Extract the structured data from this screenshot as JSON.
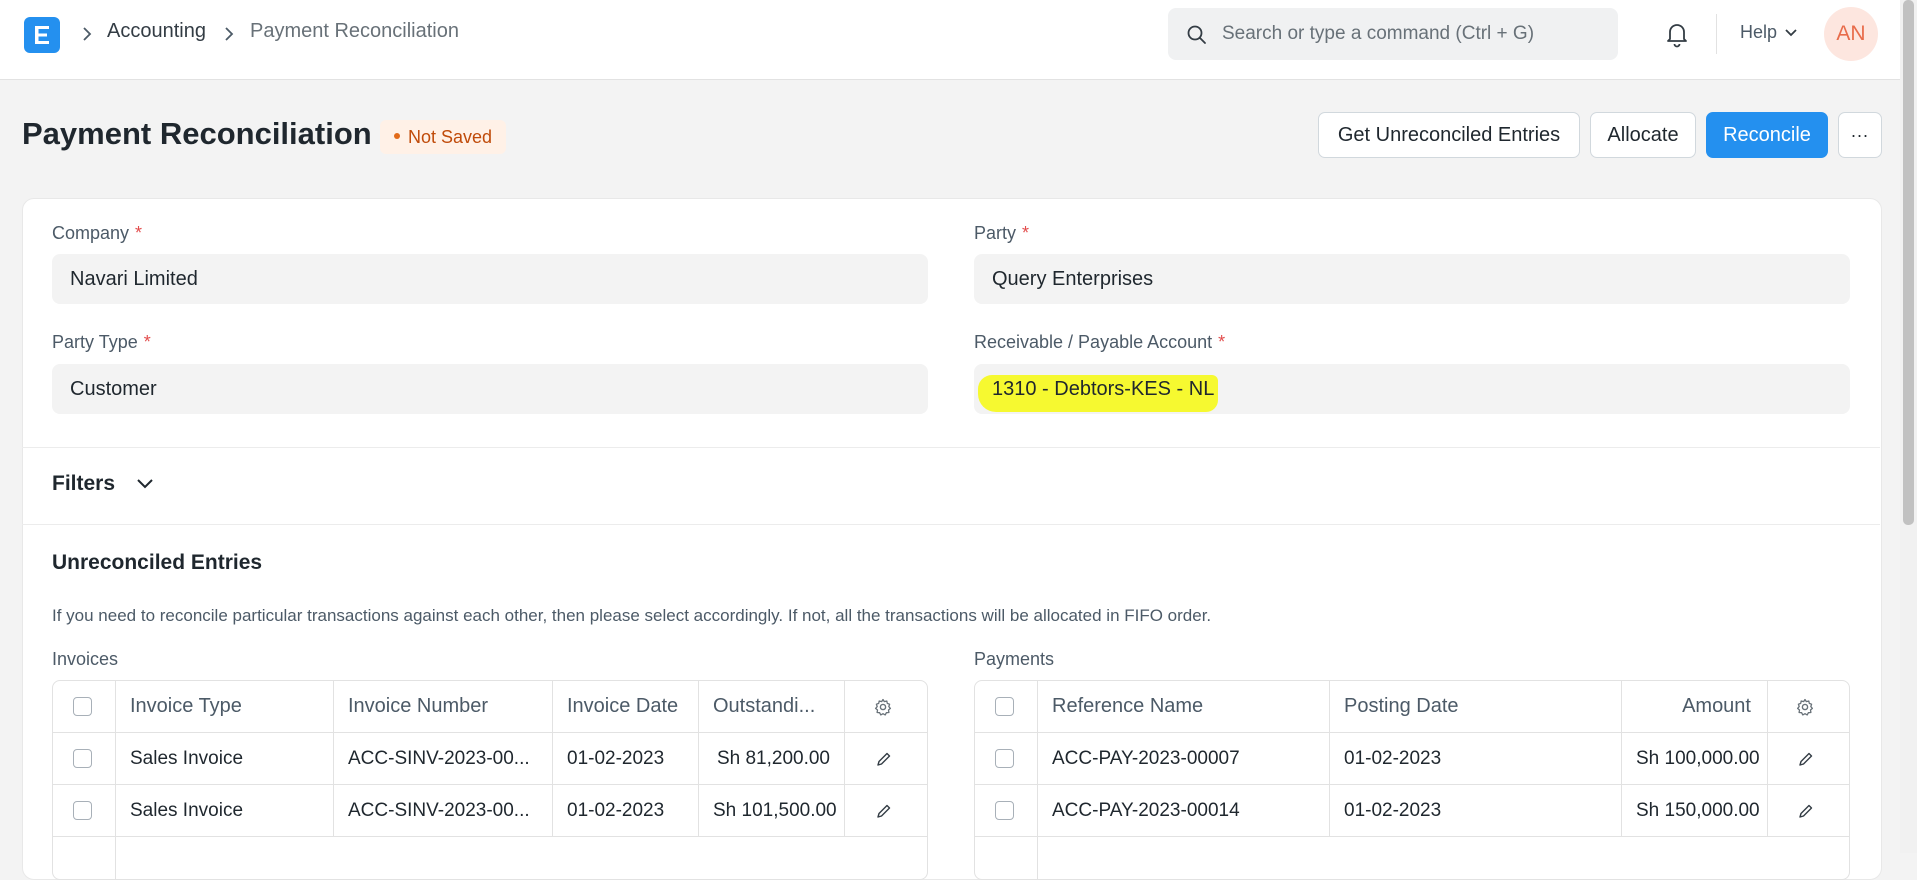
{
  "navbar": {
    "logo_letter": "E",
    "breadcrumbs": [
      "Accounting",
      "Payment Reconciliation"
    ],
    "search_placeholder": "Search or type a command (Ctrl + G)",
    "help_label": "Help",
    "avatar_initials": "AN"
  },
  "page": {
    "title": "Payment Reconciliation",
    "status_badge": "Not Saved",
    "buttons": {
      "get_unreconciled": "Get Unreconciled Entries",
      "allocate": "Allocate",
      "reconcile": "Reconcile",
      "more": "..."
    }
  },
  "form": {
    "company": {
      "label": "Company",
      "value": "Navari Limited"
    },
    "party": {
      "label": "Party",
      "value": "Query Enterprises"
    },
    "party_type": {
      "label": "Party Type",
      "value": "Customer"
    },
    "account": {
      "label": "Receivable / Payable Account",
      "value": "1310 - Debtors-KES - NL"
    },
    "required_mark": "*"
  },
  "filters": {
    "label": "Filters"
  },
  "unreconciled": {
    "title": "Unreconciled Entries",
    "help_text": "If you need to reconcile particular transactions against each other, then please select accordingly. If not, all the transactions will be allocated in FIFO order."
  },
  "invoices": {
    "label": "Invoices",
    "columns": [
      "Invoice Type",
      "Invoice Number",
      "Invoice Date",
      "Outstandi..."
    ],
    "rows": [
      {
        "type": "Sales Invoice",
        "number": "ACC-SINV-2023-00...",
        "date": "01-02-2023",
        "outstanding": "Sh 81,200.00"
      },
      {
        "type": "Sales Invoice",
        "number": "ACC-SINV-2023-00...",
        "date": "01-02-2023",
        "outstanding": "Sh 101,500.00"
      }
    ]
  },
  "payments": {
    "label": "Payments",
    "columns": [
      "Reference Name",
      "Posting Date",
      "Amount"
    ],
    "rows": [
      {
        "reference": "ACC-PAY-2023-00007",
        "date": "01-02-2023",
        "amount": "Sh 100,000.00"
      },
      {
        "reference": "ACC-PAY-2023-00014",
        "date": "01-02-2023",
        "amount": "Sh 150,000.00"
      }
    ]
  },
  "colors": {
    "primary": "#2490ef",
    "badge_bg": "#fff1e7",
    "badge_text": "#c04b0a",
    "highlight": "#f6f930",
    "required": "#e24c4c"
  }
}
